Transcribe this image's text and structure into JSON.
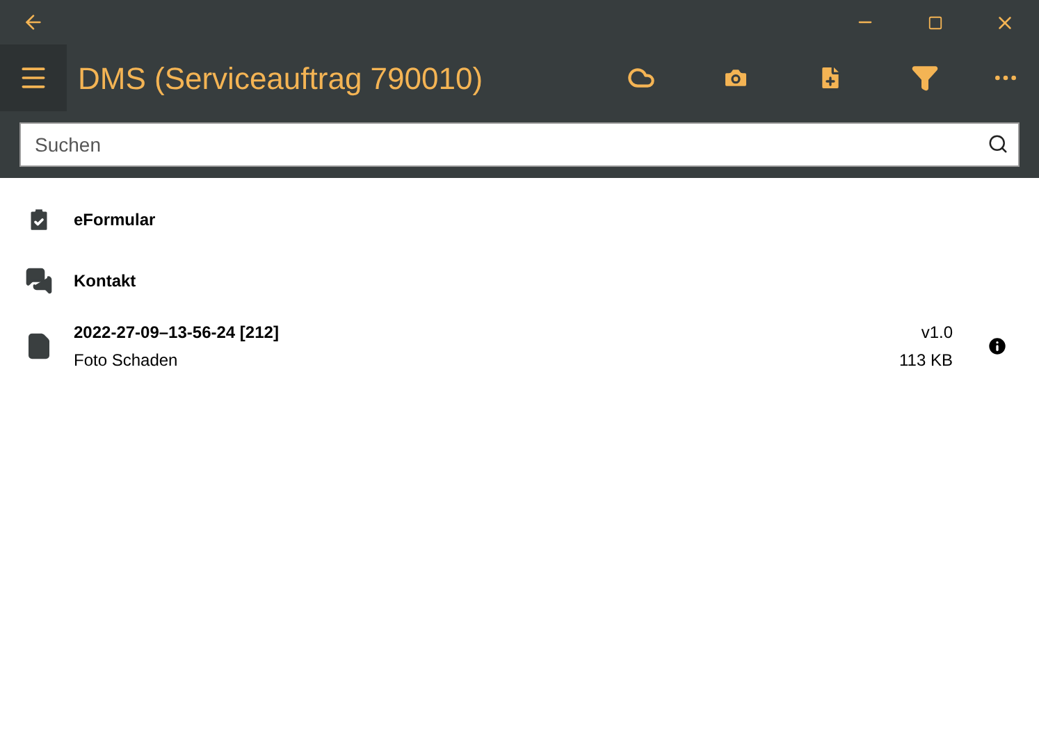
{
  "window": {
    "title": "DMS (Serviceauftrag 790010)"
  },
  "search": {
    "placeholder": "Suchen"
  },
  "items": [
    {
      "kind": "form",
      "title": "eFormular"
    },
    {
      "kind": "chat",
      "title": "Kontakt"
    },
    {
      "kind": "file",
      "title": "2022-27-09–13-56-24 [212]",
      "subtitle": "Foto Schaden",
      "version": "v1.0",
      "size": "113 KB"
    }
  ]
}
